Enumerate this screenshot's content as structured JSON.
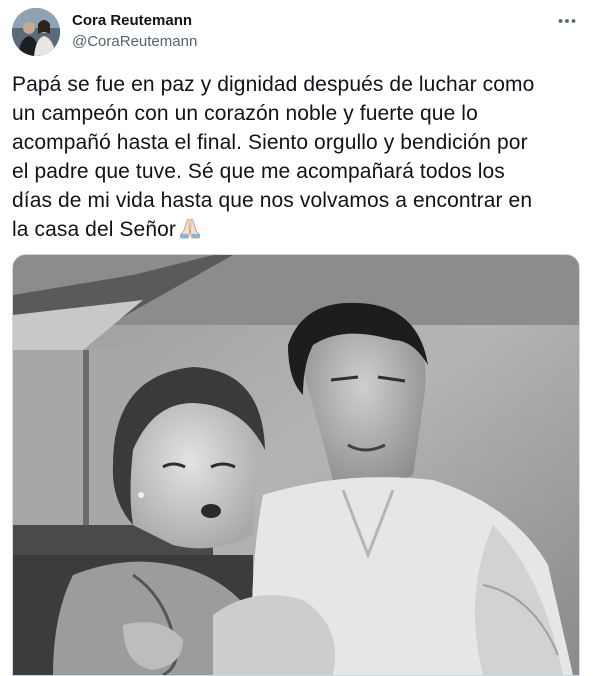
{
  "author": {
    "name": "Cora Reutemann",
    "handle": "@CoraReutemann"
  },
  "tweet": {
    "text_lines": [
      "Papá se fue en paz y dignidad después de luchar como",
      "un campeón con un corazón noble y fuerte que lo",
      "acompañó hasta el final. Siento orgullo y bendición por",
      "el padre que tuve. Sé que me acompañará todos los",
      "días de mi vida hasta que nos volvamos a encontrar en",
      "la casa del Señor"
    ],
    "emoji": "folded-hands"
  },
  "media": {
    "type": "black-and-white photo"
  },
  "icons": {
    "more": "more-horizontal-icon"
  },
  "colors": {
    "text": "#0f1419",
    "secondary": "#536471",
    "border": "#cfd9de"
  }
}
